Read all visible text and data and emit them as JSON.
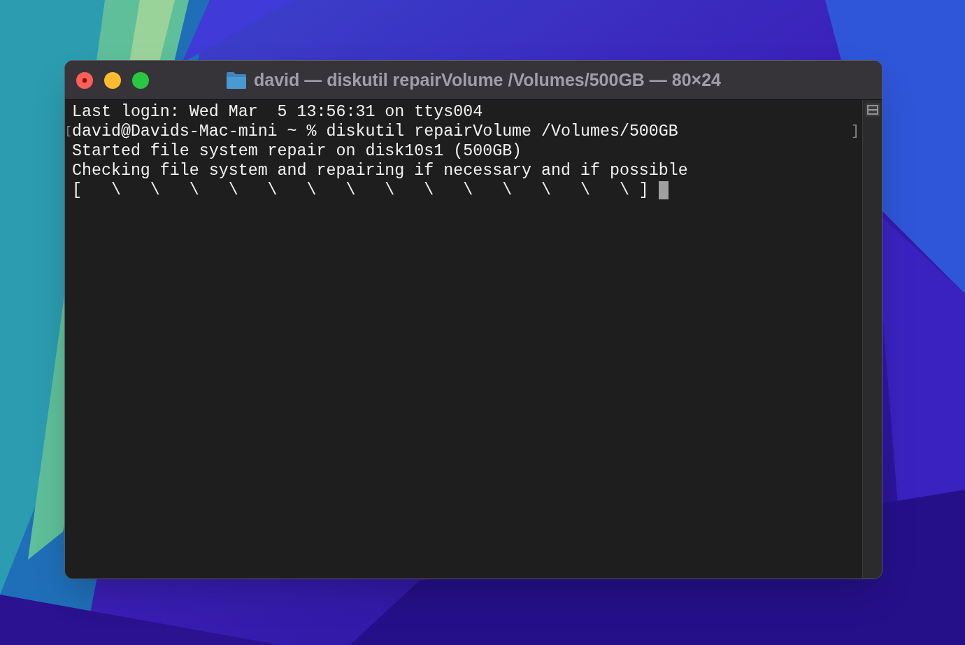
{
  "window": {
    "title": "david — diskutil repairVolume /Volumes/500GB — 80×24"
  },
  "terminal": {
    "cursor_visible": true,
    "lines": [
      {
        "text": "Last login: Wed Mar  5 13:56:31 on ttys004"
      },
      {
        "text": "david@Davids-Mac-mini ~ % diskutil repairVolume /Volumes/500GB",
        "mark_left": "[",
        "mark_right": "]"
      },
      {
        "text": "Started file system repair on disk10s1 (500GB)"
      },
      {
        "text": "Checking file system and repairing if necessary and if possible"
      },
      {
        "text": "[   \\   \\   \\   \\   \\   \\   \\   \\   \\   \\   \\   \\   \\   \\ ]"
      }
    ]
  }
}
